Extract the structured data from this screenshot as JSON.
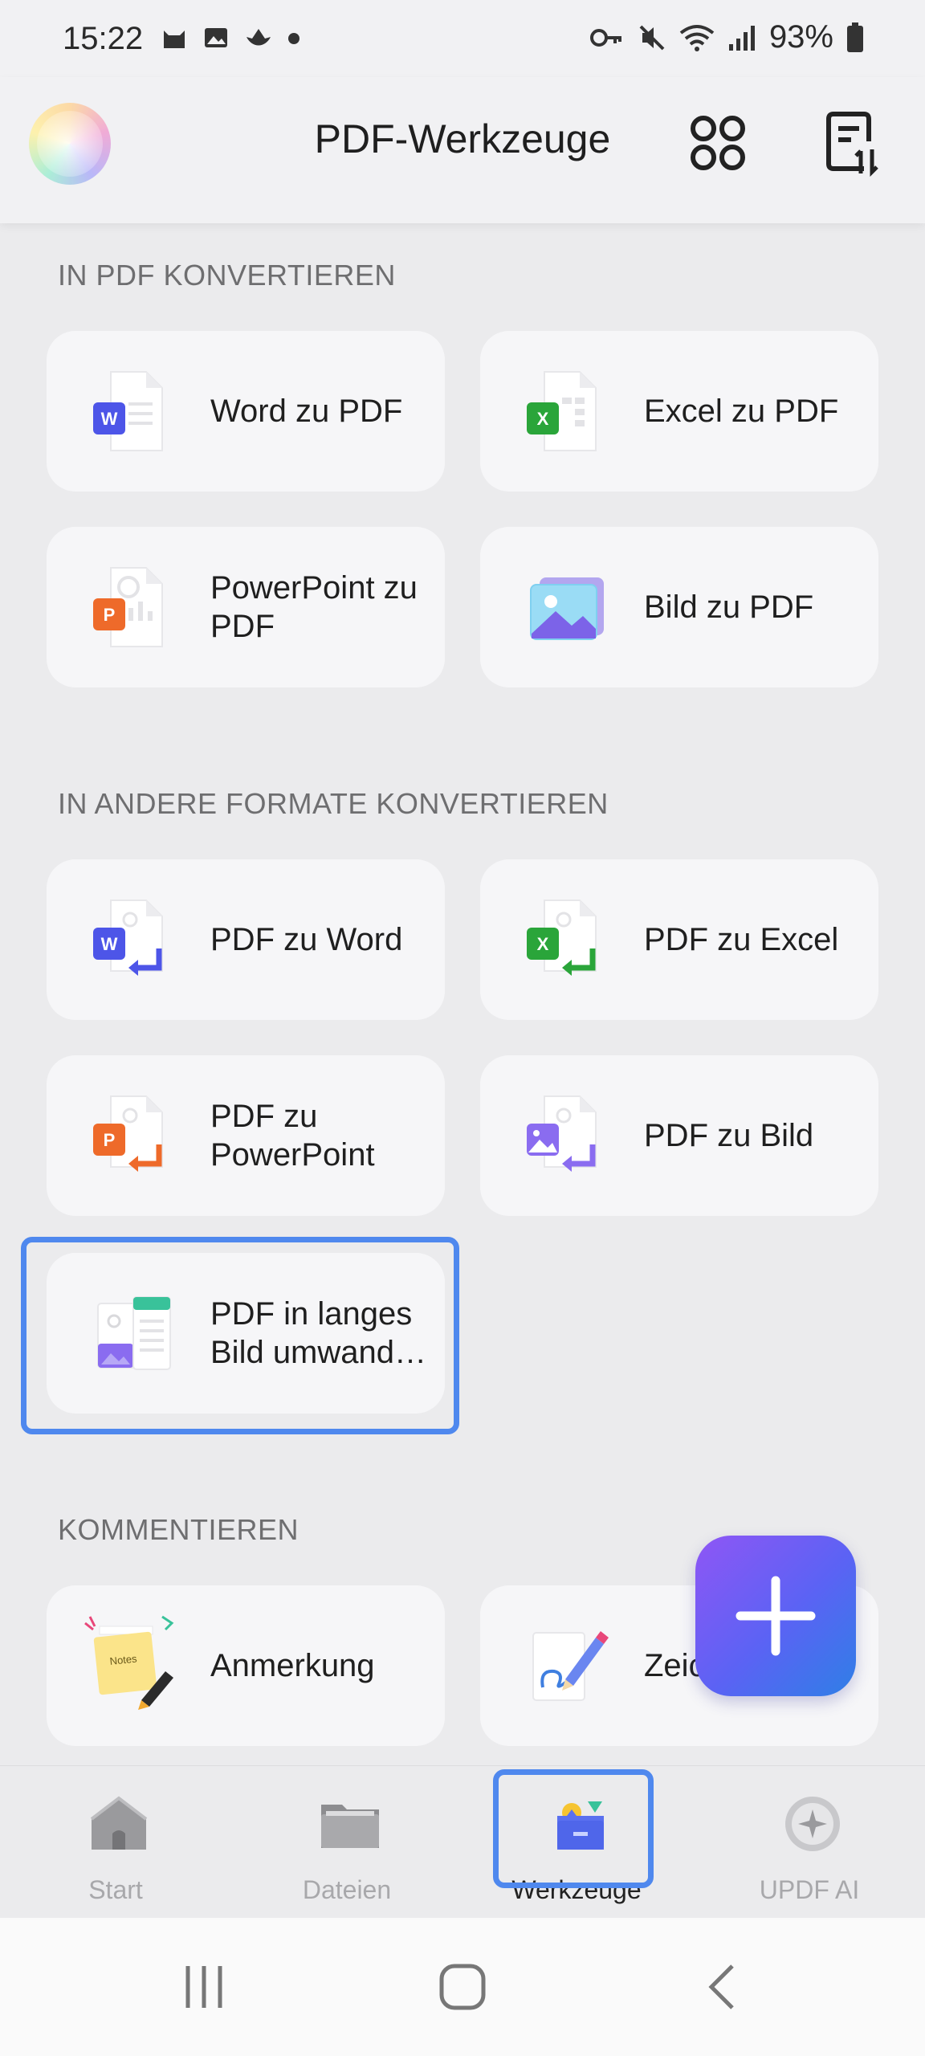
{
  "status_bar": {
    "time": "15:22",
    "battery": "93%",
    "left_icons": [
      "cat-icon",
      "image-icon",
      "bird-icon",
      "dot-icon"
    ],
    "right_icons": [
      "key-icon",
      "mute-icon",
      "wifi-icon",
      "signal-icon",
      "battery-icon"
    ]
  },
  "header": {
    "title": "PDF-Werkzeuge",
    "icons": [
      "avatar",
      "grid-icon",
      "sort-icon"
    ]
  },
  "sections": [
    {
      "title": "IN PDF KONVERTIEREN"
    },
    {
      "title": "IN ANDERE FORMATE KONVERTIEREN"
    },
    {
      "title": "KOMMENTIEREN"
    }
  ],
  "tools": {
    "word_to_pdf": "Word zu PDF",
    "excel_to_pdf": "Excel zu PDF",
    "ppt_to_pdf_1": "PowerPoint zu",
    "ppt_to_pdf_2": "PDF",
    "image_to_pdf": "Bild zu PDF",
    "pdf_to_word": "PDF zu Word",
    "pdf_to_excel": "PDF zu Excel",
    "pdf_to_ppt_1": "PDF zu",
    "pdf_to_ppt_2": "PowerPoint",
    "pdf_to_image": "PDF zu Bild",
    "pdf_long_image_1": "PDF in langes",
    "pdf_long_image_2": "Bild umwand…",
    "annotation": "Anmerkung",
    "drawing": "Zeic"
  },
  "icon_text": {
    "word_badge": "W",
    "excel_badge": "X",
    "ppt_badge": "P",
    "notes": "Notes"
  },
  "bottom_nav": [
    {
      "label": "Start",
      "icon": "home-icon"
    },
    {
      "label": "Dateien",
      "icon": "folder-icon"
    },
    {
      "label": "Werkzeuge",
      "icon": "toolbox-icon",
      "active": true
    },
    {
      "label": "UPDF AI",
      "icon": "ai-icon"
    }
  ],
  "colors": {
    "accent": "#4f88ee",
    "word": "#4d55e8",
    "excel": "#2aa53a",
    "ppt": "#ee6a2a",
    "image": "#8a6cf0"
  }
}
